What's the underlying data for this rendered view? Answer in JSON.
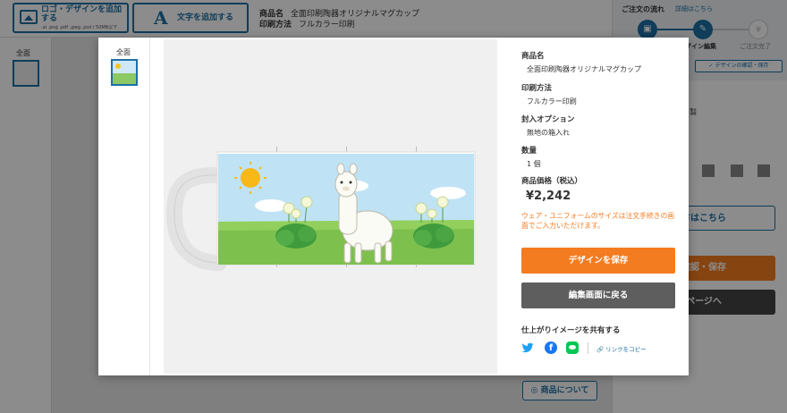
{
  "toolbar": {
    "add_logo_label": "ロゴ・デザインを追加する",
    "add_logo_sub": ".ai .png .pdf .jpeg .psd / 50MB以下",
    "add_text_glyph": "A",
    "add_text_label": "文字を追加する"
  },
  "product_info": {
    "name_label": "商品名",
    "name_value": "全面印刷陶器オリジナルマグカップ",
    "method_label": "印刷方法",
    "method_value": "フルカラー印刷"
  },
  "order_flow": {
    "title": "ご注文の流れ",
    "detail_link": "詳細はこちら",
    "step_edit": "デザイン編集",
    "step_done": "ご注文完了",
    "confirm_badge": "✓ デザインの確認・保存",
    "yen_glyph": "¥"
  },
  "editor": {
    "side_label": "全面",
    "right_partial_text": "製",
    "right_outline_btn": "り方はこちら",
    "right_orange_btn": "の確認・保存",
    "right_dark_btn": "細ページへ",
    "about_button": "商品について"
  },
  "modal": {
    "thumb_label": "全面",
    "details": {
      "product_label": "商品名",
      "product_value": "全面印刷陶器オリジナルマグカップ",
      "print_label": "印刷方法",
      "print_value": "フルカラー印刷",
      "option_label": "封入オプション",
      "option_value": "無地の箱入れ",
      "qty_label": "数量",
      "qty_value": "1 個",
      "price_label": "商品価格（税込）",
      "price_value": "¥2,242",
      "note": "ウェア・ユニフォームのサイズは注文手続きの画面でご入力いただけます。"
    },
    "save_button": "デザインを保存",
    "back_button": "編集画面に戻る",
    "share_title": "仕上がりイメージを共有する",
    "copy_link": "リンクをコピー"
  },
  "colors": {
    "accent": "#1d6fa5",
    "orange": "#f47c20",
    "dark_button": "#5e5e5e"
  }
}
